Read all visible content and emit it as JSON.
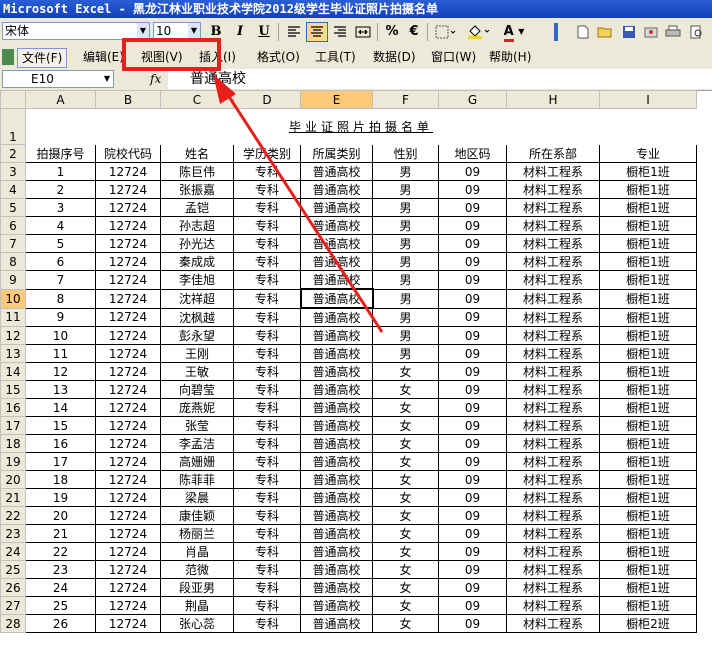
{
  "window": {
    "title": "Microsoft Excel - 黑龙江林业职业技术学院2012级学生毕业证照片拍摄名单"
  },
  "toolbar": {
    "font_name": "宋体",
    "font_size": "10",
    "bold": "B",
    "italic": "I",
    "underline": "U",
    "percent": "%",
    "euro": "€",
    "fill_color": "#f5d03a",
    "font_color_bar": "#e02020",
    "font_color_label": "A"
  },
  "menu": [
    {
      "label": "文件(F)"
    },
    {
      "label": "编辑(E)"
    },
    {
      "label": "视图(V)"
    },
    {
      "label": "插入(I)"
    },
    {
      "label": "格式(O)"
    },
    {
      "label": "工具(T)"
    },
    {
      "label": "数据(D)"
    },
    {
      "label": "窗口(W)"
    },
    {
      "label": "帮助(H)"
    }
  ],
  "formula_bar": {
    "name_box": "E10",
    "fx": "fx",
    "content": "普通高校"
  },
  "columns": [
    "A",
    "B",
    "C",
    "D",
    "E",
    "F",
    "G",
    "H",
    "I"
  ],
  "selected_column": "E",
  "selected_row": "10",
  "sheet": {
    "title": "毕业证照片拍摄名单",
    "headers": [
      "拍摄序号",
      "院校代码",
      "姓名",
      "学历类别",
      "所属类别",
      "性别",
      "地区码",
      "所在系部",
      "专业"
    ],
    "rows": [
      [
        "1",
        "12724",
        "陈巨伟",
        "专科",
        "普通高校",
        "男",
        "09",
        "材料工程系",
        "橱柜1班"
      ],
      [
        "2",
        "12724",
        "张振嘉",
        "专科",
        "普通高校",
        "男",
        "09",
        "材料工程系",
        "橱柜1班"
      ],
      [
        "3",
        "12724",
        "孟铠",
        "专科",
        "普通高校",
        "男",
        "09",
        "材料工程系",
        "橱柜1班"
      ],
      [
        "4",
        "12724",
        "孙志超",
        "专科",
        "普通高校",
        "男",
        "09",
        "材料工程系",
        "橱柜1班"
      ],
      [
        "5",
        "12724",
        "孙光达",
        "专科",
        "普通高校",
        "男",
        "09",
        "材料工程系",
        "橱柜1班"
      ],
      [
        "6",
        "12724",
        "秦成成",
        "专科",
        "普通高校",
        "男",
        "09",
        "材料工程系",
        "橱柜1班"
      ],
      [
        "7",
        "12724",
        "李佳旭",
        "专科",
        "普通高校",
        "男",
        "09",
        "材料工程系",
        "橱柜1班"
      ],
      [
        "8",
        "12724",
        "沈祥超",
        "专科",
        "普通高校",
        "男",
        "09",
        "材料工程系",
        "橱柜1班"
      ],
      [
        "9",
        "12724",
        "沈枫越",
        "专科",
        "普通高校",
        "男",
        "09",
        "材料工程系",
        "橱柜1班"
      ],
      [
        "10",
        "12724",
        "彭永望",
        "专科",
        "普通高校",
        "男",
        "09",
        "材料工程系",
        "橱柜1班"
      ],
      [
        "11",
        "12724",
        "王刚",
        "专科",
        "普通高校",
        "男",
        "09",
        "材料工程系",
        "橱柜1班"
      ],
      [
        "12",
        "12724",
        "王敏",
        "专科",
        "普通高校",
        "女",
        "09",
        "材料工程系",
        "橱柜1班"
      ],
      [
        "13",
        "12724",
        "向碧莹",
        "专科",
        "普通高校",
        "女",
        "09",
        "材料工程系",
        "橱柜1班"
      ],
      [
        "14",
        "12724",
        "庞燕妮",
        "专科",
        "普通高校",
        "女",
        "09",
        "材料工程系",
        "橱柜1班"
      ],
      [
        "15",
        "12724",
        "张莹",
        "专科",
        "普通高校",
        "女",
        "09",
        "材料工程系",
        "橱柜1班"
      ],
      [
        "16",
        "12724",
        "李孟洁",
        "专科",
        "普通高校",
        "女",
        "09",
        "材料工程系",
        "橱柜1班"
      ],
      [
        "17",
        "12724",
        "高姗姗",
        "专科",
        "普通高校",
        "女",
        "09",
        "材料工程系",
        "橱柜1班"
      ],
      [
        "18",
        "12724",
        "陈菲菲",
        "专科",
        "普通高校",
        "女",
        "09",
        "材料工程系",
        "橱柜1班"
      ],
      [
        "19",
        "12724",
        "梁晨",
        "专科",
        "普通高校",
        "女",
        "09",
        "材料工程系",
        "橱柜1班"
      ],
      [
        "20",
        "12724",
        "康佳颖",
        "专科",
        "普通高校",
        "女",
        "09",
        "材料工程系",
        "橱柜1班"
      ],
      [
        "21",
        "12724",
        "杨丽兰",
        "专科",
        "普通高校",
        "女",
        "09",
        "材料工程系",
        "橱柜1班"
      ],
      [
        "22",
        "12724",
        "肖晶",
        "专科",
        "普通高校",
        "女",
        "09",
        "材料工程系",
        "橱柜1班"
      ],
      [
        "23",
        "12724",
        "范微",
        "专科",
        "普通高校",
        "女",
        "09",
        "材料工程系",
        "橱柜1班"
      ],
      [
        "24",
        "12724",
        "段亚男",
        "专科",
        "普通高校",
        "女",
        "09",
        "材料工程系",
        "橱柜1班"
      ],
      [
        "25",
        "12724",
        "荆晶",
        "专科",
        "普通高校",
        "女",
        "09",
        "材料工程系",
        "橱柜1班"
      ],
      [
        "26",
        "12724",
        "张心蕊",
        "专科",
        "普通高校",
        "女",
        "09",
        "材料工程系",
        "橱柜2班"
      ]
    ]
  },
  "annotation": {
    "color": "#e8201c"
  }
}
